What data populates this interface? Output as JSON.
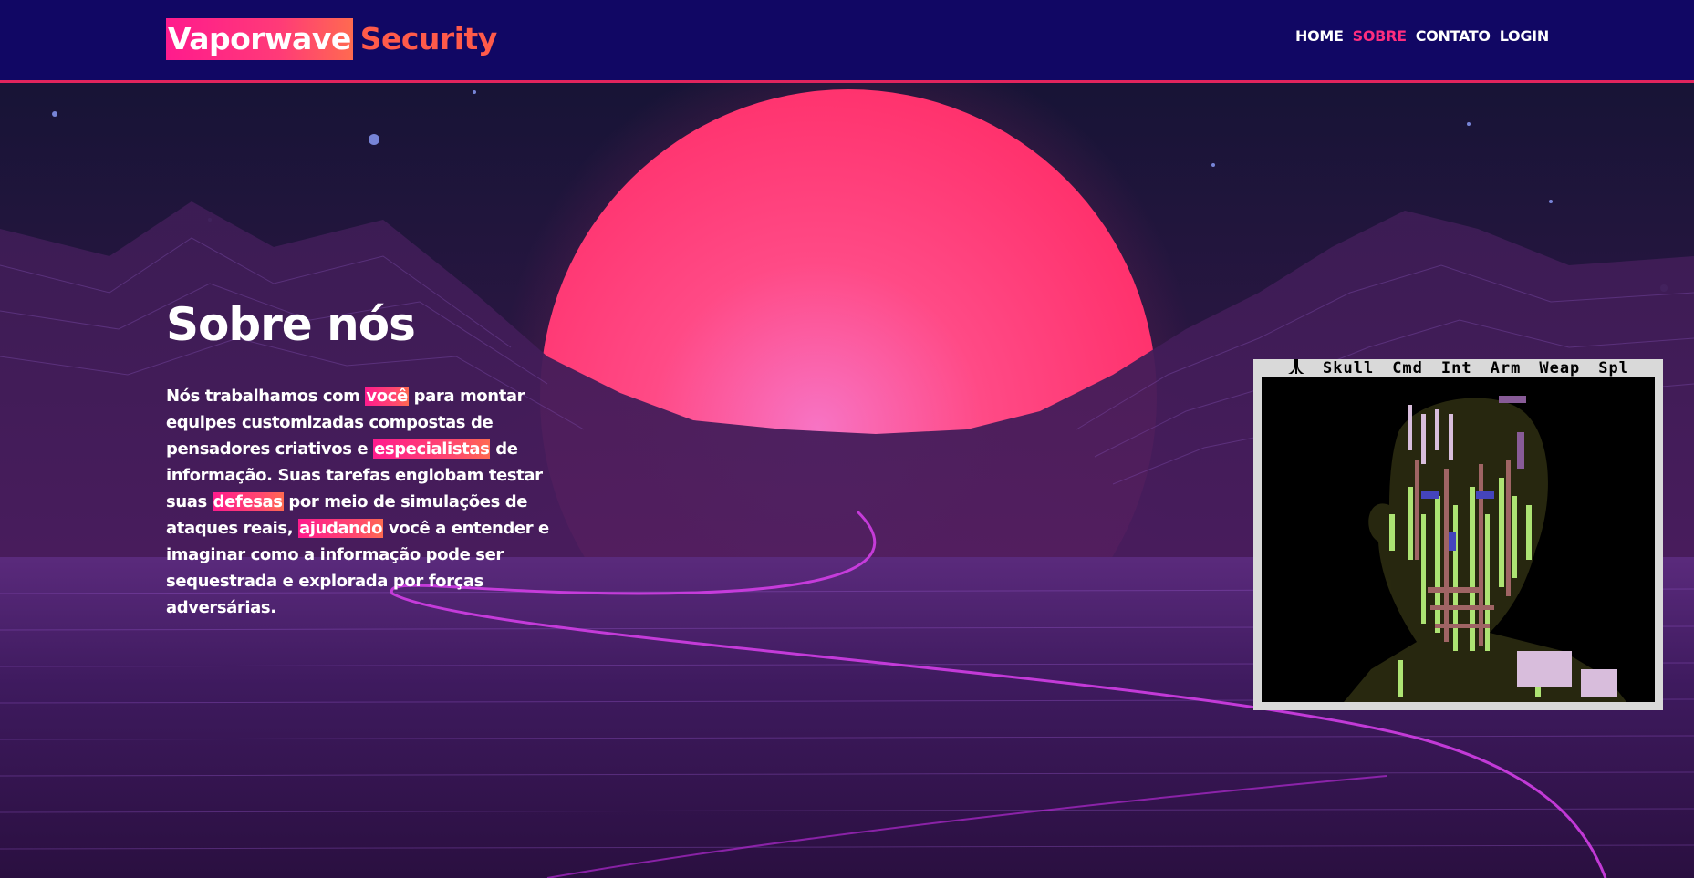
{
  "brand": {
    "part1": "Vaporwave",
    "part2": "Security"
  },
  "nav": {
    "items": [
      "HOME",
      "SOBRE",
      "CONTATO",
      "LOGIN"
    ],
    "active": "SOBRE"
  },
  "about": {
    "title": "Sobre nós",
    "text": [
      "Nós trabalhamos com ",
      "você",
      " para montar equipes customizadas compostas de pensadores criativos e ",
      "especialistas",
      " de informação. Suas tarefas englobam testar suas ",
      "defesas",
      " por meio de simulações de ataques reais, ",
      "ajudando",
      " você a entender e imaginar como a informação pode ser sequestrada e explorada por forças adversárias."
    ]
  },
  "game": {
    "menu": [
      "Skull",
      "Cmd",
      "Int",
      "Arm",
      "Weap",
      "Spl"
    ],
    "logo_icon": "atari-logo-icon"
  },
  "colors": {
    "header_bg": "#110764",
    "accent": "#ff2d7e",
    "sun": "#ff3a78",
    "brand_secondary": "#ff5a4a"
  }
}
